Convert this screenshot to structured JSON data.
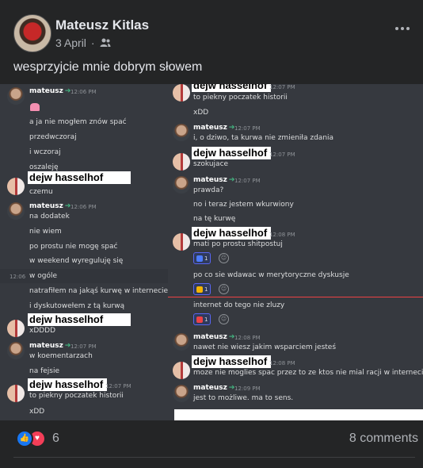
{
  "post": {
    "author": "Mateusz Kitlas",
    "date": "3 April",
    "dot": "·",
    "caption": "wesprzyjcie mnie dobrym słowem",
    "reactions_count": "6",
    "comments": "8 comments"
  },
  "left_chat": {
    "m1": {
      "user": "mateusz",
      "time": "12:06 PM",
      "lines": [
        "a ja nie mogłem znów spać",
        "przedwczoraj",
        "i wczoraj",
        "oszaleję"
      ]
    },
    "m2": {
      "user": "dejw hasselhof",
      "lines": [
        "czemu"
      ]
    },
    "m3": {
      "user": "mateusz",
      "time": "12:06 PM",
      "lines": [
        "na dodatek",
        "nie wiem",
        "po prostu nie mogę spać",
        "w weekend wyreguluję się",
        "w ogóle",
        "natrafiłem na jakąś kurwę w internecie",
        "i dyskutowełem z tą kurwą"
      ],
      "hover_time": "12:06"
    },
    "m4": {
      "user": "dejw hasselhof",
      "lines": [
        "xDDDD"
      ]
    },
    "m5": {
      "user": "mateusz",
      "time": "12:07 PM",
      "lines": [
        "w koementarzach",
        "na fejsie"
      ]
    },
    "m6": {
      "user": "dejw hasselhof",
      "time": "12:07 PM",
      "lines": [
        "to piekny poczatek historii",
        "xDD"
      ]
    }
  },
  "right_chat": {
    "r1": {
      "user": "dejw hasselhof",
      "time": "12:07 PM",
      "lines": [
        "to piekny poczatek historii",
        "xDD"
      ]
    },
    "r2": {
      "user": "mateusz",
      "time": "12:07 PM",
      "lines": [
        "i, o dziwo, ta kurwa nie zmieniła zdania"
      ]
    },
    "r3": {
      "user": "dejw hasselhof",
      "time": "12:07 PM",
      "lines": [
        "szokujace"
      ]
    },
    "r4": {
      "user": "mateusz",
      "time": "12:07 PM",
      "lines": [
        "prawda?",
        "no i teraz jestem wkurwiony",
        "na tę kurwę"
      ]
    },
    "r5": {
      "user": "dejw hasselhof",
      "time": "12:08 PM",
      "lines": [
        "mati po prostu shitpostuj",
        "po co sie wdawac w merytoryczne dyskusje",
        "internet do tego nie zluzy"
      ],
      "reactions": [
        "1",
        "1",
        "1"
      ]
    },
    "r6": {
      "user": "mateusz",
      "time": "12:08 PM",
      "lines": [
        "nawet nie wiesz jakim wsparciem jesteś"
      ]
    },
    "r7": {
      "user": "dejw hasselhof",
      "time": "12:08 PM",
      "lines": [
        "moze nie moglies spac przez to ze ktos nie mial racji w internecie wlasnie"
      ]
    },
    "r8": {
      "user": "mateusz",
      "time": "12:09 PM",
      "lines": [
        "jest to możliwe. ma to sens."
      ]
    }
  },
  "colors": {
    "bg": "#242526",
    "chat_bg": "#36393f",
    "online_green": "#43b581",
    "like_blue": "#1877f2",
    "love_red": "#f33e58"
  },
  "icons": [
    "friends-icon",
    "more-icon",
    "like-icon",
    "love-icon",
    "add-reaction-icon"
  ]
}
